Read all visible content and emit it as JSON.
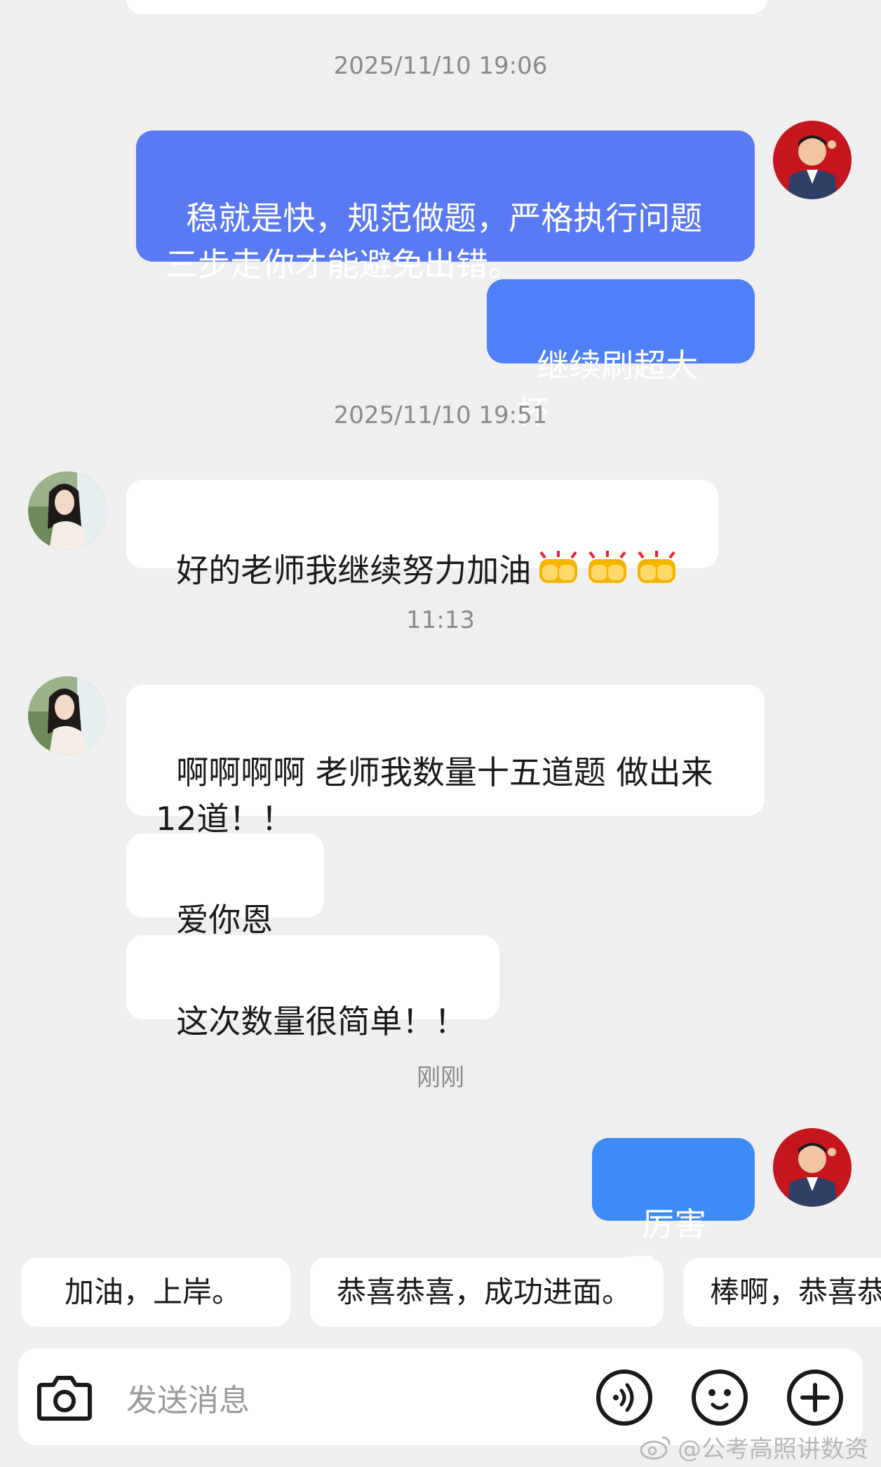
{
  "messages": {
    "ts1": "2025/11/10 19:06",
    "out1": "稳就是快，规范做题，严格执行问题\n三步走你才能避免出错。",
    "out2": "继续刷超大杯",
    "ts2": "2025/11/10 19:51",
    "in1": "好的老师我继续努力加油",
    "in1_emoji": "fist-bump-emoji x3",
    "ts3": "11:13",
    "in2": "啊啊啊啊 老师我数量十五道题 做出来\n12道！！",
    "in3": "爱你恩师",
    "in4": "这次数量很简单！！",
    "ts4": "刚刚",
    "out3": "厉害啊"
  },
  "quick_replies": [
    "加油，上岸。",
    "恭喜恭喜，成功进面。",
    "棒啊，恭喜恭"
  ],
  "composer": {
    "placeholder": "发送消息",
    "icons": [
      "camera-icon",
      "voice-icon",
      "emoji-icon",
      "plus-icon"
    ]
  },
  "watermark": "@公考高照讲数资",
  "colors": {
    "background": "#efefef",
    "outgoing_bubble": "#5a7af3",
    "incoming_bubble": "#ffffff",
    "timestamp": "#8a8a8a"
  }
}
